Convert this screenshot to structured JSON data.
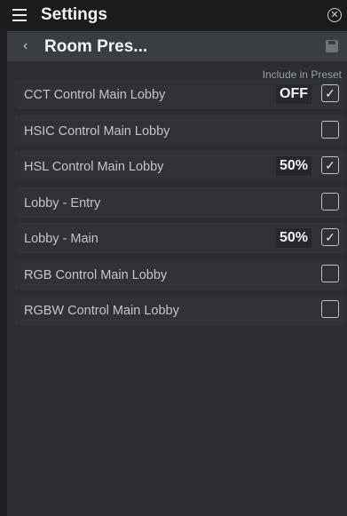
{
  "header": {
    "title": "Settings"
  },
  "subheader": {
    "title": "Room Pres..."
  },
  "list": {
    "column_header": "Include in Preset",
    "rows": [
      {
        "label": "CCT Control Main Lobby",
        "value": "OFF",
        "checked": true
      },
      {
        "label": "HSIC Control Main Lobby",
        "value": "",
        "checked": false
      },
      {
        "label": "HSL Control Main Lobby",
        "value": "50%",
        "checked": true
      },
      {
        "label": "Lobby - Entry",
        "value": "",
        "checked": false
      },
      {
        "label": "Lobby - Main",
        "value": "50%",
        "checked": true
      },
      {
        "label": "RGB Control Main Lobby",
        "value": "",
        "checked": false
      },
      {
        "label": "RGBW Control Main Lobby",
        "value": "",
        "checked": false
      }
    ]
  },
  "icons": {
    "menu": "hamburger-menu-icon",
    "close": "close-circle-icon",
    "back": "chevron-left-icon",
    "save": "save-disk-icon",
    "check": "checkmark-icon"
  },
  "colors": {
    "background": "#1d1f22",
    "header_bar": "#3a3d41",
    "panel": "#2b2d30",
    "row": "#303236"
  }
}
